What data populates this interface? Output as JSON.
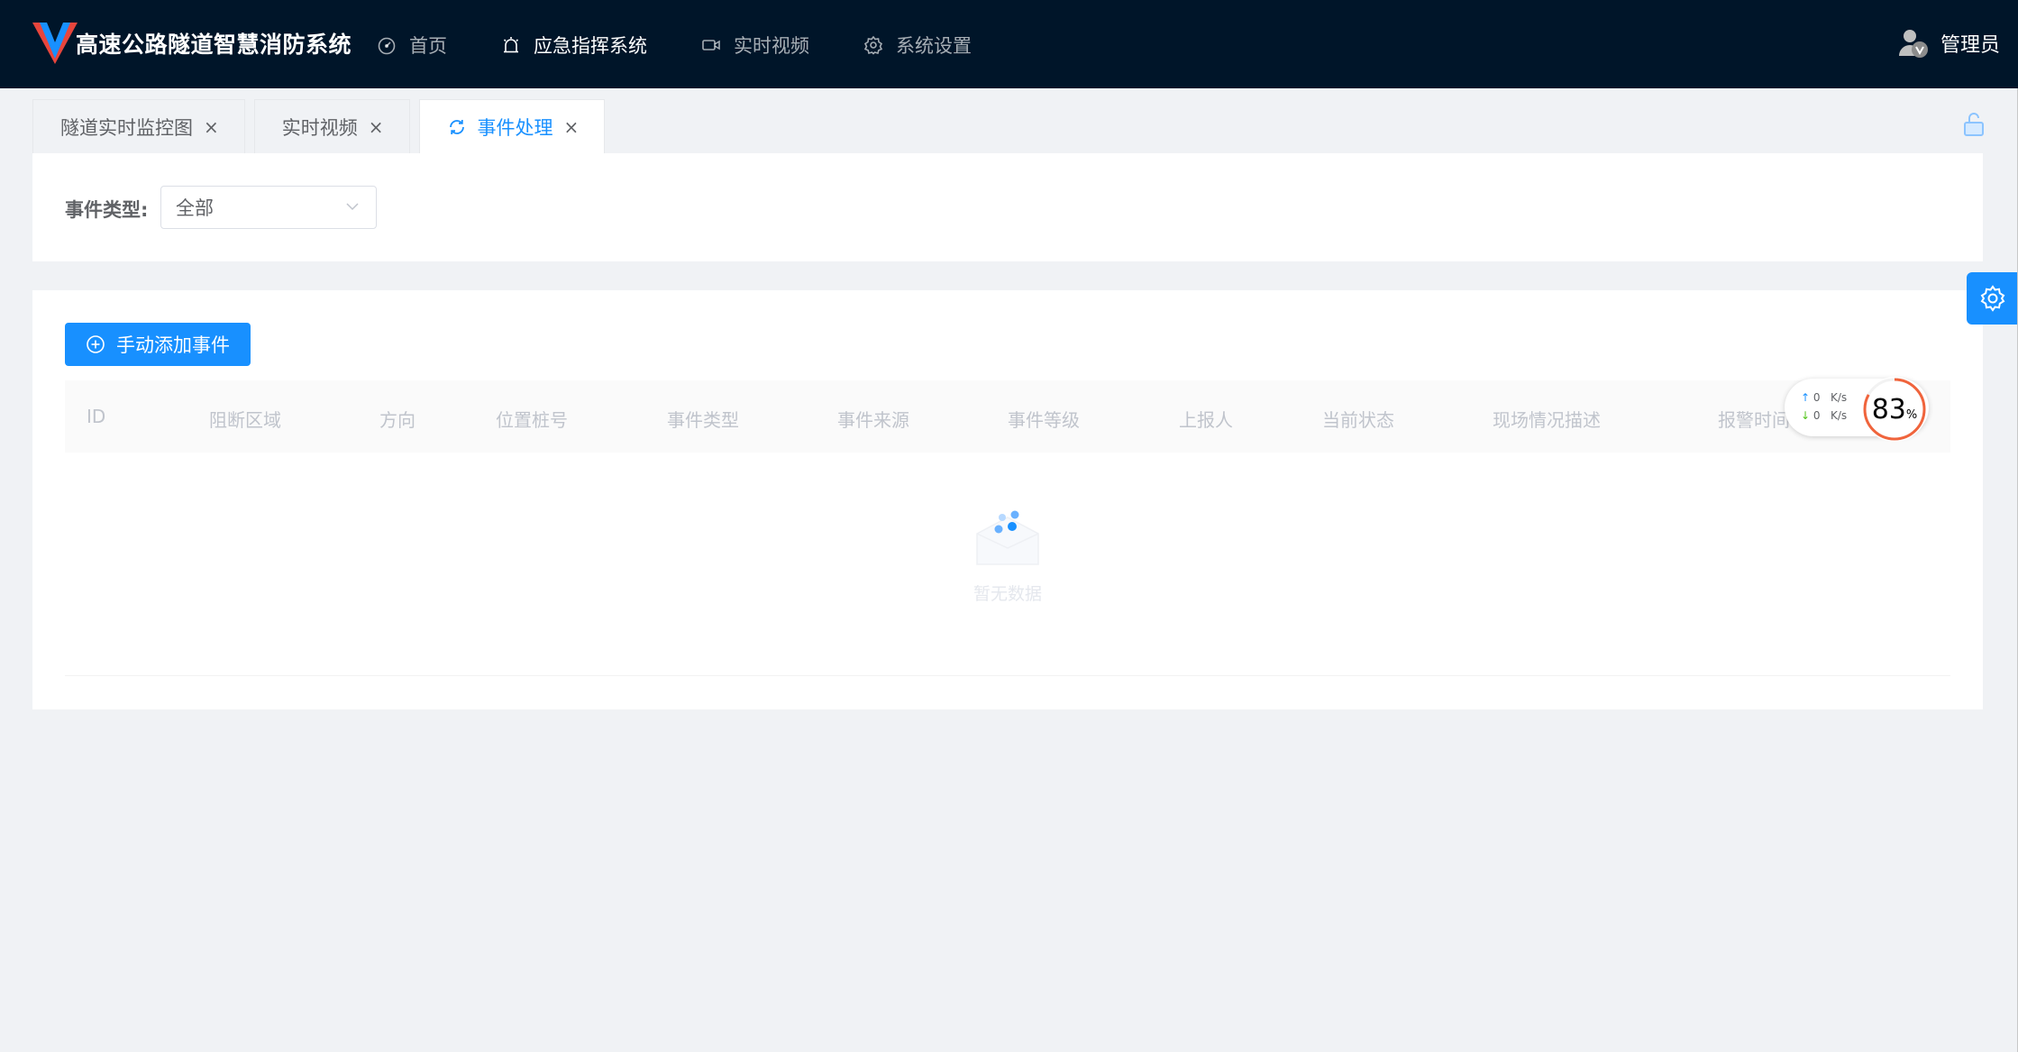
{
  "app": {
    "title": "高速公路隧道智慧消防系统"
  },
  "nav": [
    {
      "label": "首页",
      "icon": "dashboard-icon"
    },
    {
      "label": "应急指挥系统",
      "icon": "alarm-icon"
    },
    {
      "label": "实时视频",
      "icon": "video-icon"
    },
    {
      "label": "系统设置",
      "icon": "gear-icon"
    }
  ],
  "user": {
    "name": "管理员"
  },
  "tabs": [
    {
      "label": "隧道实时监控图"
    },
    {
      "label": "实时视频"
    },
    {
      "label": "事件处理"
    }
  ],
  "filter": {
    "label": "事件类型:",
    "selected": "全部"
  },
  "toolbar": {
    "add_label": "手动添加事件"
  },
  "table": {
    "columns": [
      "ID",
      "阻断区域",
      "方向",
      "位置桩号",
      "事件类型",
      "事件来源",
      "事件等级",
      "上报人",
      "当前状态",
      "现场情况描述",
      "报警时间"
    ],
    "empty_text": "暂无数据"
  },
  "speed_widget": {
    "up": "0",
    "down": "0",
    "unit": "K/s",
    "percent": 83,
    "percent_sign": "%"
  },
  "colors": {
    "topbar": "#001529",
    "primary": "#1890ff",
    "background": "#f0f2f5"
  }
}
